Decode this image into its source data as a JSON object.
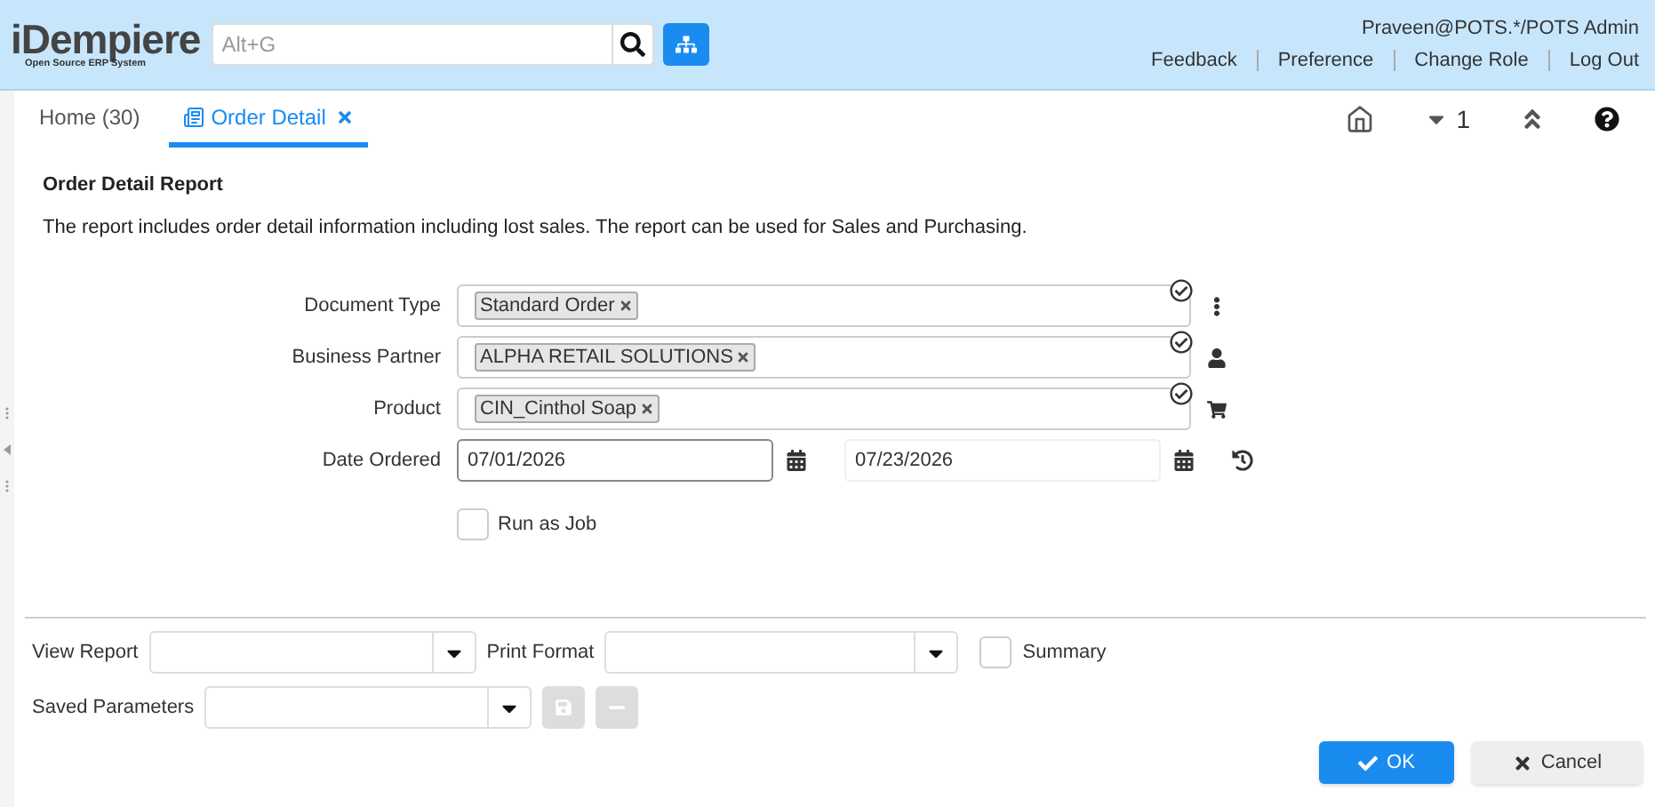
{
  "header": {
    "logo": "iDempiere",
    "logo_tagline": "Open Source ERP System",
    "search": {
      "placeholder": "Alt+G"
    },
    "user": "Praveen@POTS.*/POTS Admin",
    "links": [
      "Feedback",
      "Preference",
      "Change Role",
      "Log Out"
    ]
  },
  "tabs": [
    {
      "label": "Home (30)",
      "selected": false,
      "closable": false
    },
    {
      "label": "Order Detail",
      "selected": true,
      "closable": true
    }
  ],
  "toolbar": {
    "window_count": "1"
  },
  "report": {
    "title": "Order Detail Report",
    "description": "The report includes order detail information including lost sales. The report can be used for Sales and Purchasing."
  },
  "parameters": [
    {
      "kind": "chips",
      "label": "Document Type",
      "chips": [
        "Standard Order"
      ]
    },
    {
      "kind": "chips",
      "label": "Business Partner",
      "chips": [
        "ALPHA RETAIL SOLUTIONS"
      ]
    },
    {
      "kind": "chips",
      "label": "Product",
      "chips": [
        "CIN_Cinthol Soap"
      ]
    },
    {
      "kind": "daterange",
      "label": "Date Ordered",
      "from": "07/01/2026",
      "to": "07/23/2026"
    },
    {
      "kind": "checkbox",
      "label": "Run as Job",
      "checked": false
    }
  ],
  "footer": {
    "view_report": {
      "label": "View Report"
    },
    "print_format": {
      "label": "Print Format"
    },
    "summary": {
      "label": "Summary",
      "checked": false
    },
    "saved_parameters": {
      "label": "Saved Parameters"
    },
    "buttons": [
      {
        "kind": "ok",
        "label": "OK"
      },
      {
        "kind": "cancel",
        "label": "Cancel"
      }
    ]
  }
}
